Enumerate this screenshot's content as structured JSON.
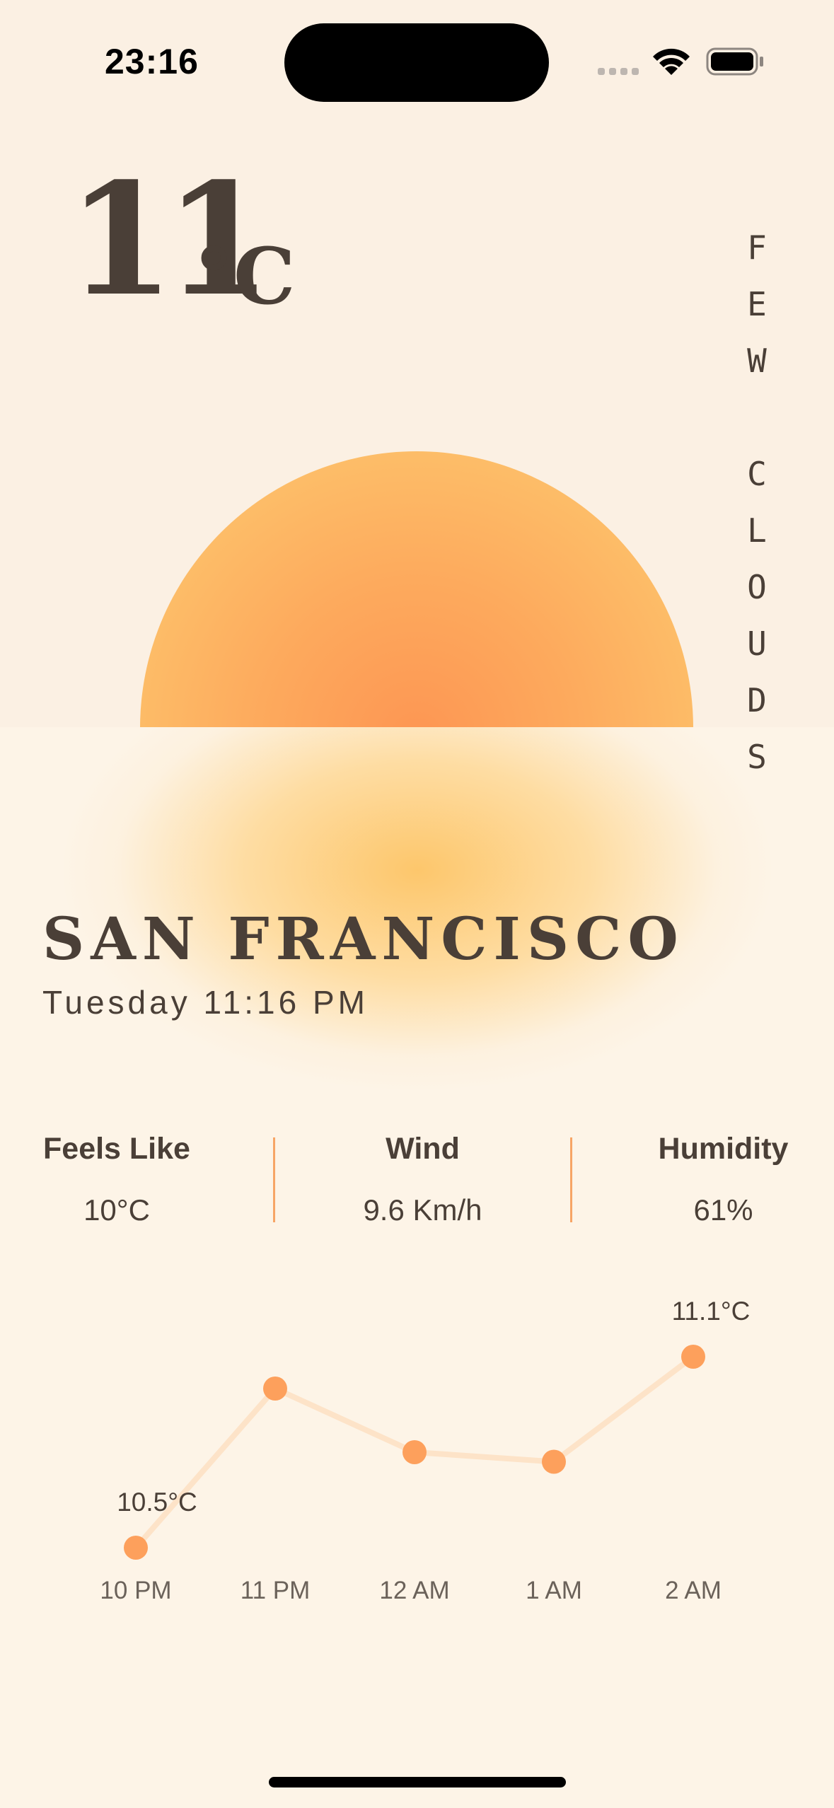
{
  "status_bar": {
    "time": "23:16"
  },
  "current": {
    "temperature": "11",
    "unit": "°C",
    "condition": "FEW CLOUDS",
    "city": "SAN FRANCISCO",
    "datetime": "Tuesday 11:16 PM"
  },
  "stats": {
    "feels_like": {
      "label": "Feels Like",
      "value": "10°C"
    },
    "wind": {
      "label": "Wind",
      "value": "9.6 Km/h"
    },
    "humidity": {
      "label": "Humidity",
      "value": "61%"
    }
  },
  "colors": {
    "background": "#fdf4e7",
    "text": "#4a3f37",
    "accent": "#fda05c",
    "line": "#fde3c8"
  },
  "chart_data": {
    "type": "line",
    "categories": [
      "10 PM",
      "11 PM",
      "12 AM",
      "1 AM",
      "2 AM"
    ],
    "values": [
      10.5,
      11.0,
      10.8,
      10.77,
      11.1
    ],
    "point_labels": [
      "10.5°C",
      "",
      "",
      "",
      "11.1°C"
    ],
    "ylim": [
      10.5,
      11.1
    ]
  }
}
